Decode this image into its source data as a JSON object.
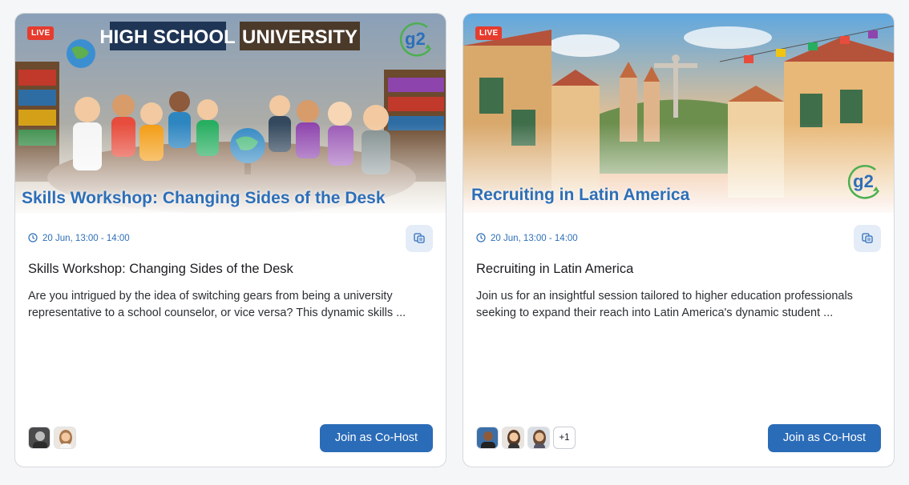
{
  "cards": [
    {
      "live_label": "LIVE",
      "banner_title": "Skills Workshop: Changing Sides of the Desk",
      "banner_signs": [
        "HIGH SCHOOL",
        "UNIVERSITY"
      ],
      "logo_text": "g2",
      "datetime": "20 Jun, 13:00 - 14:00",
      "title": "Skills Workshop: Changing Sides of the Desk",
      "description": "Are you intrigued by the idea of switching gears from being a university representative to a school counselor, or vice versa? This dynamic skills ...",
      "join_label": "Join as Co-Host",
      "avatar_count": 2
    },
    {
      "live_label": "LIVE",
      "banner_title": "Recruiting in Latin America",
      "logo_text": "g2",
      "datetime": "20 Jun, 13:00 - 14:00",
      "title": "Recruiting in Latin America",
      "description": "Join us for an insightful session tailored to higher education professionals seeking to expand their reach into Latin America's dynamic student ...",
      "join_label": "Join as Co-Host",
      "avatar_count": 3,
      "more_avatars": "+1"
    }
  ],
  "colors": {
    "accent": "#2b6cb8",
    "live": "#e53c2e",
    "text": "#1b1d21"
  },
  "icons": [
    "clock-icon",
    "copy-icon",
    "g2-logo"
  ]
}
